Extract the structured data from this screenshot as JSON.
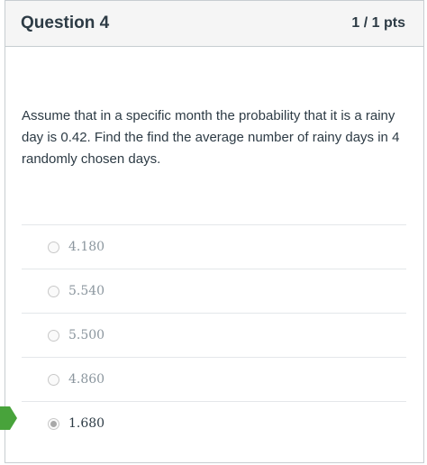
{
  "question": {
    "title": "Question 4",
    "points": "1 / 1 pts",
    "text": "Assume that in a specific month the probability that it is a rainy day is 0.42. Find the find the average number of rainy days in 4 randomly chosen days."
  },
  "answers": [
    {
      "label": "4.180",
      "selected": false
    },
    {
      "label": "5.540",
      "selected": false
    },
    {
      "label": "5.500",
      "selected": false
    },
    {
      "label": "4.860",
      "selected": false
    },
    {
      "label": "1.680",
      "selected": true
    }
  ],
  "colors": {
    "correct_flag": "#48a33b",
    "text": "#2d3b45",
    "header_bg": "#f5f5f5"
  }
}
